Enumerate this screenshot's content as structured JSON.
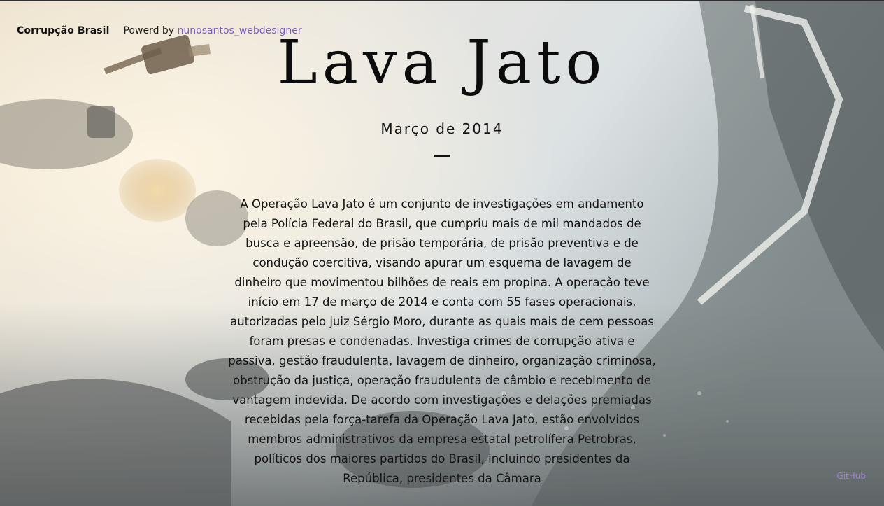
{
  "nav": {
    "brand": "Corrupção Brasil",
    "powered_prefix": "Powerd by",
    "powered_link": "nunosantos_webdesigner"
  },
  "hero": {
    "title": "Lava Jato",
    "date": "Março de 2014"
  },
  "body": {
    "paragraph": "A Operação Lava Jato é um conjunto de investigações em andamento pela Polícia Federal do Brasil, que cumpriu mais de mil mandados de busca e apreensão, de prisão temporária, de prisão preventiva e de condução coercitiva, visando apurar um esquema de lavagem de dinheiro que movimentou bilhões de reais em propina. A operação teve início em 17 de março de 2014 e conta com 55 fases operacionais, autorizadas pelo juiz Sérgio Moro, durante as quais mais de cem pessoas foram presas e condenadas. Investiga crimes de corrupção ativa e passiva, gestão fraudulenta, lavagem de dinheiro, organização criminosa, obstrução da justiça, operação fraudulenta de câmbio e recebimento de vantagem indevida. De acordo com investigações e delações premiadas recebidas pela força-tarefa da Operação Lava Jato, estão envolvidos membros administrativos da empresa estatal petrolífera Petrobras, políticos dos maiores partidos do Brasil, incluindo presidentes da República, presidentes da Câmara"
  },
  "corner_link": "GitHub",
  "colors": {
    "link": "#7d5cc0",
    "text": "#111111"
  }
}
